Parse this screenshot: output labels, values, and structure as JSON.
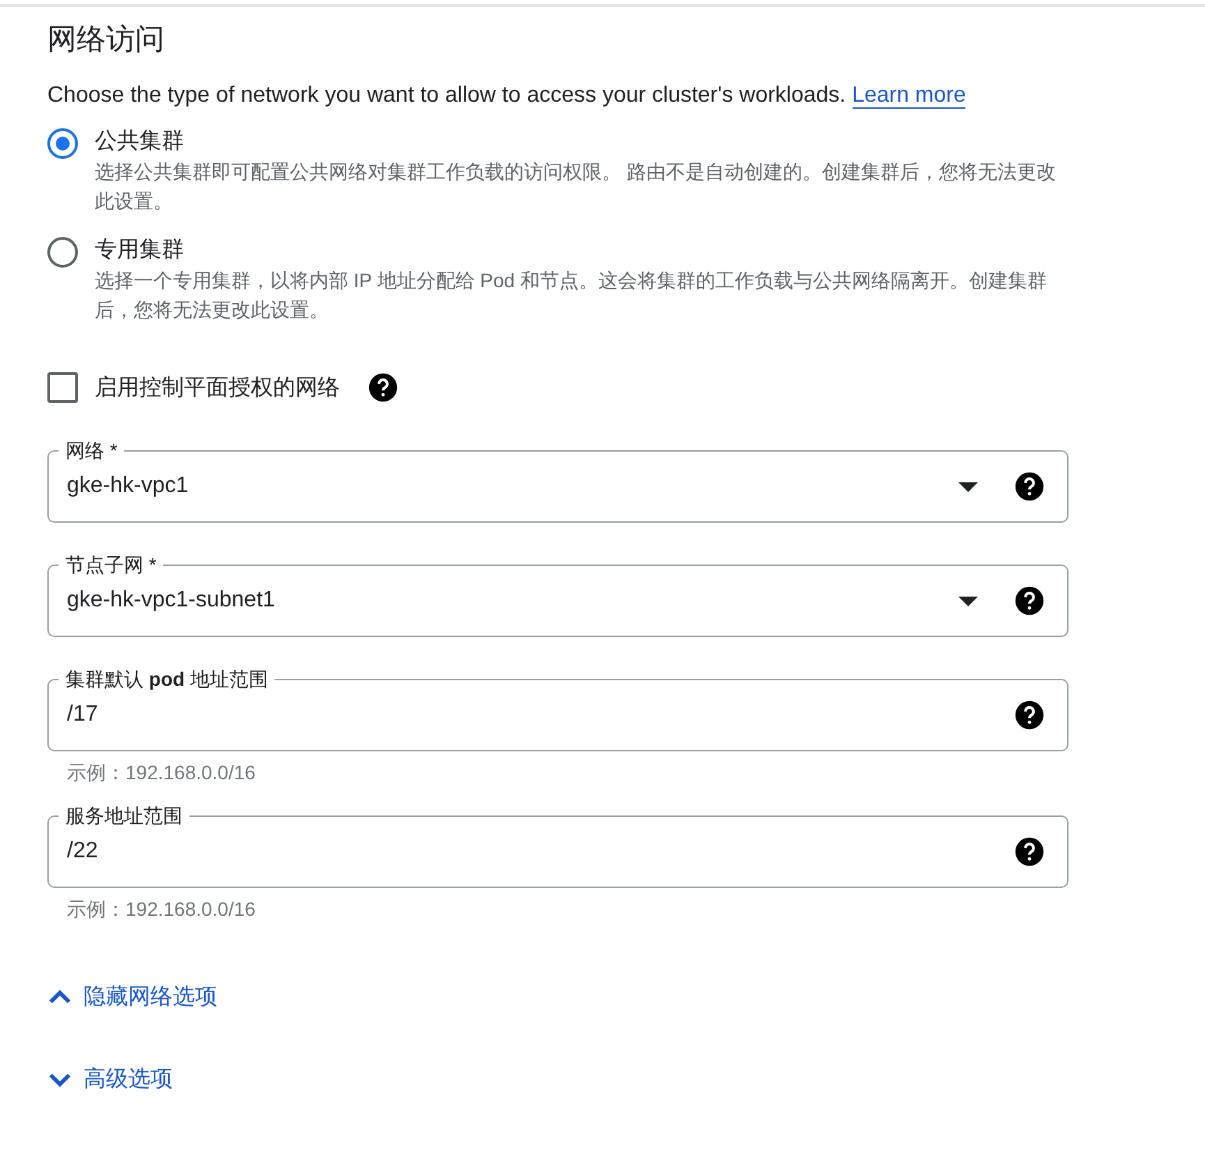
{
  "title": "网络访问",
  "description": {
    "text": "Choose the type of network you want to allow to access your cluster's workloads.",
    "link": "Learn more"
  },
  "radios": [
    {
      "label": "公共集群",
      "detail": "选择公共集群即可配置公共网络对集群工作负载的访问权限。 路由不是自动创建的。创建集群后，您将无法更改此设置。",
      "selected": true
    },
    {
      "label": "专用集群",
      "detail": "选择一个专用集群，以将内部 IP 地址分配给 Pod 和节点。这会将集群的工作负载与公共网络隔离开。创建集群后，您将无法更改此设置。",
      "selected": false
    }
  ],
  "checkbox": {
    "label": "启用控制平面授权的网络",
    "checked": false
  },
  "fields": [
    {
      "kind": "select",
      "label": "网络 *",
      "value": "gke-hk-vpc1"
    },
    {
      "kind": "select",
      "label": "节点子网 *",
      "value": "gke-hk-vpc1-subnet1"
    },
    {
      "kind": "text",
      "label": "集群默认 **pod** 地址范围",
      "value": "/17",
      "hint": "示例：192.168.0.0/16"
    },
    {
      "kind": "text",
      "label": "服务地址范围",
      "value": "/22",
      "hint": "示例：192.168.0.0/16"
    }
  ],
  "toggles": [
    {
      "label": "隐藏网络选项",
      "expanded": true
    },
    {
      "label": "高级选项",
      "expanded": false
    }
  ]
}
